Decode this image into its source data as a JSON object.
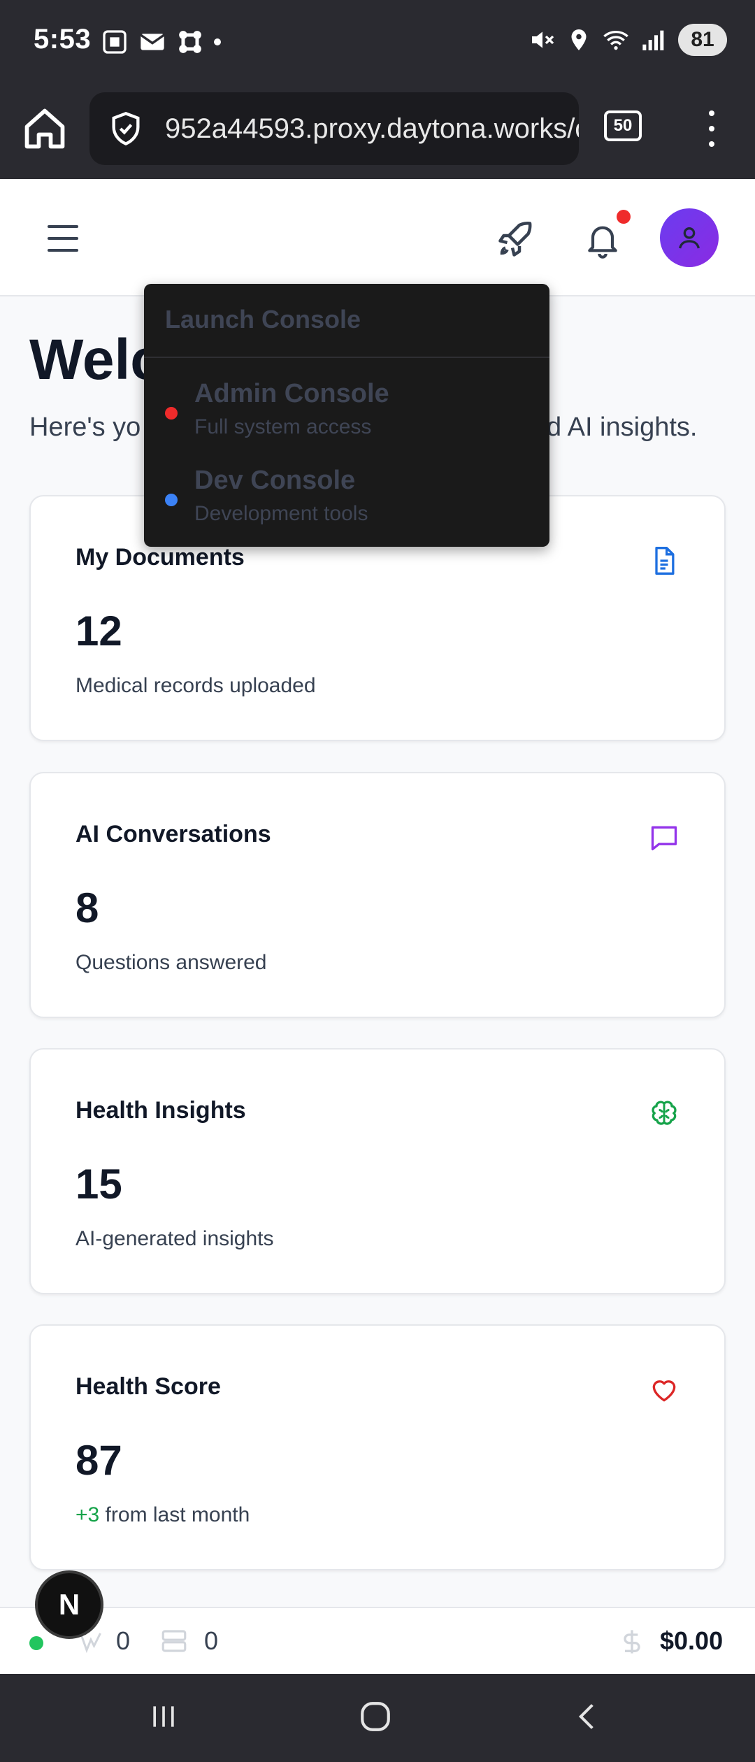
{
  "status_bar": {
    "time": "5:53",
    "battery": "81"
  },
  "browser": {
    "url": "952a44593.proxy.daytona.works/c",
    "tab_count": "50"
  },
  "welcome": {
    "title": "Welc",
    "subtitle_left": "Here's yo",
    "subtitle_right": "d AI insights."
  },
  "dropdown": {
    "header": "Launch Console",
    "items": [
      {
        "name": "Admin Console",
        "desc": "Full system access",
        "color": "#ef2b2b"
      },
      {
        "name": "Dev Console",
        "desc": "Development tools",
        "color": "#3b82f6"
      }
    ]
  },
  "cards": [
    {
      "title": "My Documents",
      "value": "12",
      "desc": "Medical records uploaded",
      "icon": "document-icon",
      "icon_color": "#1d6fe0"
    },
    {
      "title": "AI Conversations",
      "value": "8",
      "desc": "Questions answered",
      "icon": "chat-icon",
      "icon_color": "#9333ea"
    },
    {
      "title": "Health Insights",
      "value": "15",
      "desc": "AI-generated insights",
      "icon": "brain-icon",
      "icon_color": "#16a34a"
    },
    {
      "title": "Health Score",
      "value": "87",
      "desc_change": "+3",
      "desc": " from last month",
      "icon": "heart-icon",
      "icon_color": "#dc2626"
    }
  ],
  "bottom_bar": {
    "count_a": "0",
    "count_b": "0",
    "cost": "$0.00",
    "badge": "N"
  }
}
